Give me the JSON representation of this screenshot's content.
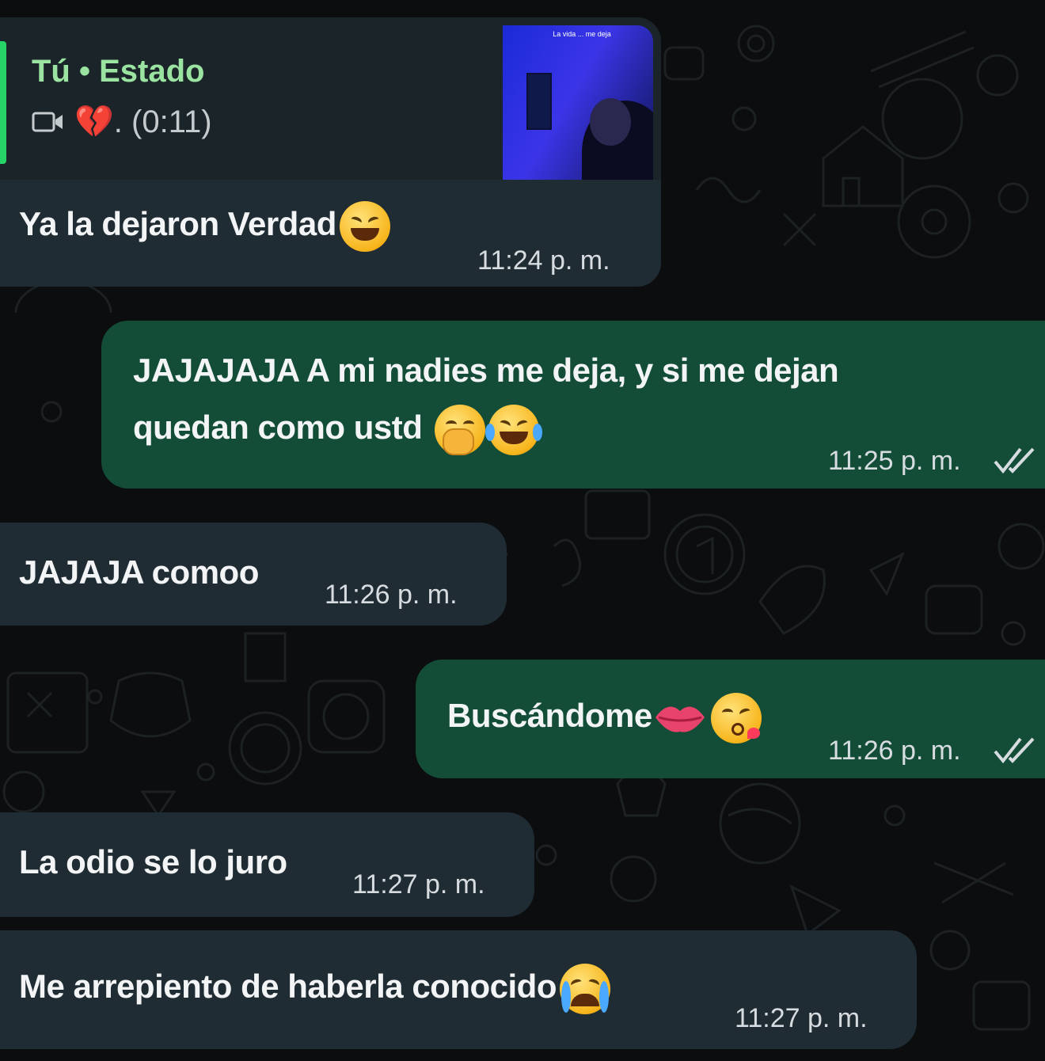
{
  "status_reply": {
    "author": "Tú • Estado",
    "media_duration": "💔. (0:11)",
    "thumbnail_caption": "La vida ... me deja"
  },
  "messages": [
    {
      "direction": "incoming",
      "text": "Ya la dejaron Verdad",
      "emoji": "laughing-face",
      "time": "11:24 p. m."
    },
    {
      "direction": "outgoing",
      "text_line1": "JAJAJAJA A mi nadies me deja, y si me dejan",
      "text_line2": "quedan como ustd",
      "emoji": "hand-over-mouth, tears-of-joy",
      "time": "11:25 p. m.",
      "status": "read"
    },
    {
      "direction": "incoming",
      "text": "JAJAJA comoo",
      "time": "11:26 p. m."
    },
    {
      "direction": "outgoing",
      "text": "Buscándome",
      "emoji": "kiss-mark, face-blowing-kiss",
      "time": "11:26 p. m.",
      "status": "read"
    },
    {
      "direction": "incoming",
      "text": "La odio se lo juro",
      "time": "11:27 p. m."
    },
    {
      "direction": "incoming",
      "text": "Me arrepiento de haberla conocido",
      "emoji": "loudly-crying-face",
      "time": "11:27 p. m."
    }
  ],
  "colors": {
    "background": "#0b0d0e",
    "incoming_bubble": "#202c33",
    "outgoing_bubble": "#134d37",
    "status_accent": "#25d366"
  }
}
